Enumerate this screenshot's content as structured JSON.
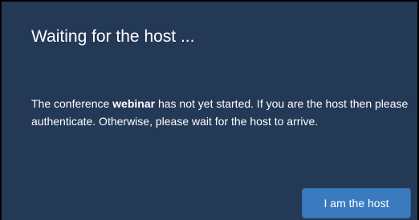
{
  "dialog": {
    "title": "Waiting for the host ...",
    "message_prefix": "The conference ",
    "conference_name": "webinar",
    "message_suffix": " has not yet started. If you are the host then please authenticate. Otherwise, please wait for the host to arrive.",
    "host_button_label": "I am the host"
  },
  "colors": {
    "dialog_background": "#243956",
    "button_background": "#3a7bbf",
    "text": "#ffffff"
  }
}
